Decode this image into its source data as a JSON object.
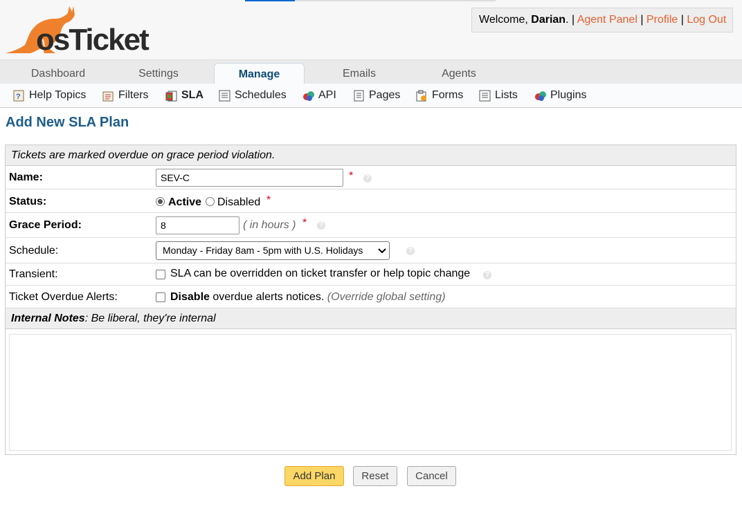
{
  "header": {
    "logo_text": "osTicket",
    "welcome_prefix": "Welcome, ",
    "user_name": "Darian",
    "welcome_suffix": ". | ",
    "links": [
      "Agent Panel",
      "Profile",
      "Log Out"
    ],
    "separator": " | "
  },
  "nav": {
    "tabs": [
      "Dashboard",
      "Settings",
      "Manage",
      "Emails",
      "Agents"
    ],
    "active": "Manage"
  },
  "subnav": {
    "items": [
      "Help Topics",
      "Filters",
      "SLA",
      "Schedules",
      "API",
      "Pages",
      "Forms",
      "Lists",
      "Plugins"
    ],
    "active": "SLA"
  },
  "page": {
    "title": "Add New SLA Plan",
    "notice": "Tickets are marked overdue on grace period violation."
  },
  "form": {
    "name": {
      "label": "Name:",
      "value": "SEV-C",
      "required": "*"
    },
    "status": {
      "label": "Status:",
      "options": [
        "Active",
        "Disabled"
      ],
      "selected": "Active",
      "required": "*"
    },
    "grace": {
      "label": "Grace Period:",
      "value": "8",
      "unit": "( in hours )",
      "required": "*"
    },
    "schedule": {
      "label": "Schedule:",
      "selected": "Monday - Friday 8am - 5pm with U.S. Holidays"
    },
    "transient": {
      "label": "Transient:",
      "text": "SLA can be overridden on ticket transfer or help topic change",
      "checked": false
    },
    "overdue": {
      "label": "Ticket Overdue Alerts:",
      "bold_text": "Disable",
      "text": " overdue alerts notices.",
      "note": "(Override global setting)",
      "checked": false
    },
    "notes": {
      "label": "Internal Notes",
      "hint": ": Be liberal, they're internal",
      "value": ""
    }
  },
  "buttons": {
    "add": "Add Plan",
    "reset": "Reset",
    "cancel": "Cancel"
  },
  "colors": {
    "accent_link": "#e2612f",
    "title": "#1d5d8c",
    "primary_button": "#fdd766",
    "logo_orange": "#f0812c",
    "logo_dark": "#2b2b2b"
  }
}
